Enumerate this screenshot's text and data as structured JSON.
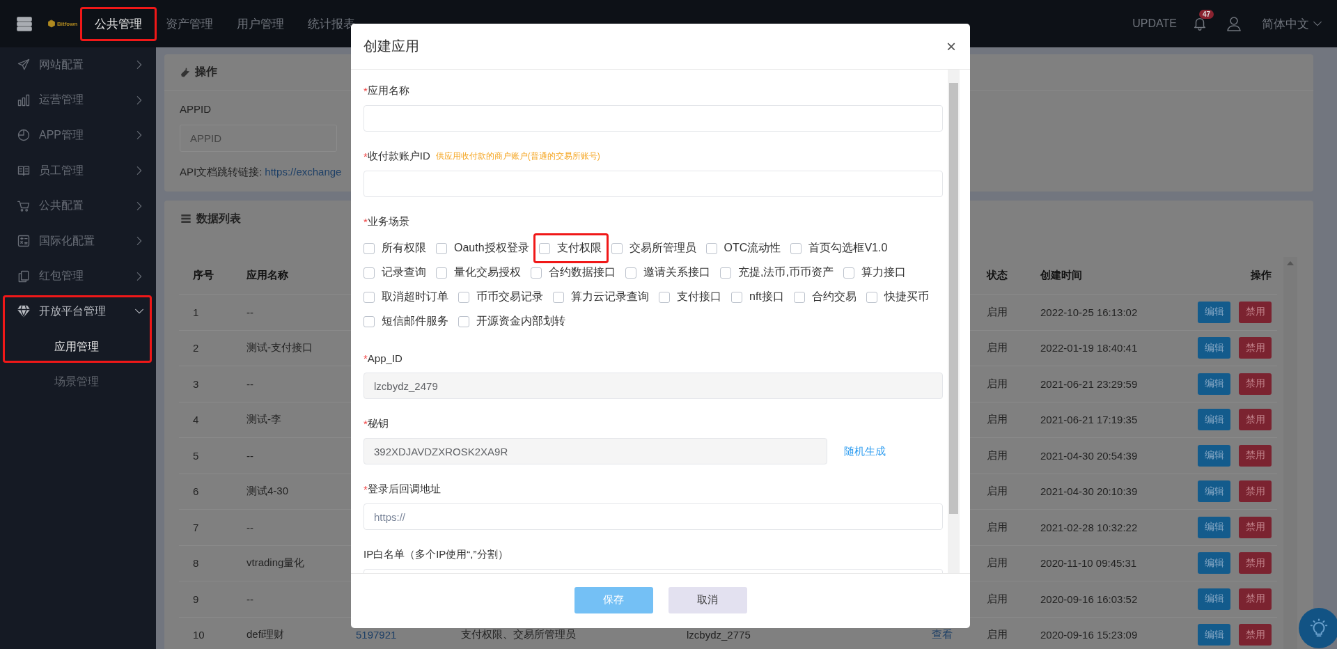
{
  "topbar": {
    "brand": "Bitfown",
    "nav": [
      {
        "label": "公共管理",
        "selected": true,
        "highlighted": true
      },
      {
        "label": "资产管理",
        "selected": false,
        "highlighted": false
      },
      {
        "label": "用户管理",
        "selected": false,
        "highlighted": false
      },
      {
        "label": "统计报表",
        "selected": false,
        "highlighted": false
      }
    ],
    "update": "UPDATE",
    "badge": "47",
    "language": "简体中文"
  },
  "sidebar": {
    "items": [
      {
        "label": "网站配置",
        "expanded": false,
        "highlighted": false
      },
      {
        "label": "运营管理",
        "expanded": false,
        "highlighted": false
      },
      {
        "label": "APP管理",
        "expanded": false,
        "highlighted": false
      },
      {
        "label": "员工管理",
        "expanded": false,
        "highlighted": false
      },
      {
        "label": "公共配置",
        "expanded": false,
        "highlighted": false
      },
      {
        "label": "国际化配置",
        "expanded": false,
        "highlighted": false
      },
      {
        "label": "红包管理",
        "expanded": false,
        "highlighted": false
      },
      {
        "label": "开放平台管理",
        "expanded": true,
        "highlighted": true,
        "children": [
          {
            "label": "应用管理",
            "selected": true
          },
          {
            "label": "场景管理",
            "selected": false
          }
        ]
      }
    ]
  },
  "operations": {
    "title": "操作",
    "appid_label": "APPID",
    "appid_placeholder": "APPID",
    "link_label": "API文档跳转链接:",
    "link": "https://exchange"
  },
  "table": {
    "title": "数据列表",
    "columns": [
      "序号",
      "应用名称",
      "状态",
      "创建时间",
      "操作"
    ],
    "rows": [
      {
        "no": "1",
        "name": "--",
        "status": "启用",
        "created": "2022-10-25 16:13:02",
        "actions": [
          "编辑",
          "禁用"
        ]
      },
      {
        "no": "2",
        "name": "测试-支付接口",
        "status": "启用",
        "created": "2022-01-19 18:40:41",
        "actions": [
          "编辑",
          "禁用"
        ]
      },
      {
        "no": "3",
        "name": "--",
        "status": "启用",
        "created": "2021-06-21 23:29:59",
        "actions": [
          "编辑",
          "禁用"
        ]
      },
      {
        "no": "4",
        "name": "测试-李",
        "status": "启用",
        "created": "2021-06-21 17:19:35",
        "actions": [
          "编辑",
          "禁用"
        ]
      },
      {
        "no": "5",
        "name": "--",
        "status": "启用",
        "created": "2021-04-30 20:54:39",
        "actions": [
          "编辑",
          "禁用"
        ]
      },
      {
        "no": "6",
        "name": "测试4-30",
        "status": "启用",
        "created": "2021-04-30 20:10:39",
        "actions": [
          "编辑",
          "禁用"
        ]
      },
      {
        "no": "7",
        "name": "--",
        "status": "启用",
        "created": "2021-02-28 10:32:22",
        "actions": [
          "编辑",
          "禁用"
        ]
      },
      {
        "no": "8",
        "name": "vtrading量化",
        "status": "启用",
        "created": "2020-11-10 09:45:31",
        "actions": [
          "编辑",
          "禁用"
        ]
      },
      {
        "no": "9",
        "name": "--",
        "status": "启用",
        "created": "2020-09-16 16:03:52",
        "actions": [
          "编辑",
          "禁用"
        ]
      },
      {
        "no": "10",
        "name": "defi理财",
        "column_3": "5197921",
        "column_4": "支付权限、交易所管理员",
        "column_5": "lzcbydz_2775",
        "column_6": "查看",
        "status": "启用",
        "created": "2020-09-16 15:23:09",
        "actions": [
          "编辑",
          "禁用"
        ]
      }
    ]
  },
  "dialog": {
    "title": "创建应用",
    "close": "×",
    "fields": [
      {
        "kind": "text",
        "mark": "*",
        "label": "应用名称"
      },
      {
        "kind": "text",
        "mark": "*",
        "label": "收付款账户ID",
        "hint": "供应用收付款的商户账户(普通的交易所账号)"
      },
      {
        "kind": "checkboxes",
        "mark": "*",
        "label": "业务场景",
        "options": [
          {
            "label": "所有权限",
            "checked": false,
            "highlighted": false
          },
          {
            "label": "Oauth授权登录",
            "checked": false,
            "highlighted": false
          },
          {
            "label": "支付权限",
            "checked": false,
            "highlighted": true
          },
          {
            "label": "交易所管理员",
            "checked": false,
            "highlighted": false
          },
          {
            "label": "OTC流动性",
            "checked": false,
            "highlighted": false
          },
          {
            "label": "首页勾选框V1.0",
            "checked": false,
            "highlighted": false
          },
          {
            "label": "记录查询",
            "checked": false,
            "highlighted": false
          },
          {
            "label": "量化交易授权",
            "checked": false,
            "highlighted": false
          },
          {
            "label": "合约数据接口",
            "checked": false,
            "highlighted": false
          },
          {
            "label": "邀请关系接口",
            "checked": false,
            "highlighted": false
          },
          {
            "label": "充提,法币,币币资产",
            "checked": false,
            "highlighted": false
          },
          {
            "label": "算力接口",
            "checked": false,
            "highlighted": false
          },
          {
            "label": "取消超时订单",
            "checked": false,
            "highlighted": false
          },
          {
            "label": "币币交易记录",
            "checked": false,
            "highlighted": false
          },
          {
            "label": "算力云记录查询",
            "checked": false,
            "highlighted": false
          },
          {
            "label": "支付接口",
            "checked": false,
            "highlighted": false
          },
          {
            "label": "nft接口",
            "checked": false,
            "highlighted": false
          },
          {
            "label": "合约交易",
            "checked": false,
            "highlighted": false
          },
          {
            "label": "快捷买币",
            "checked": false,
            "highlighted": false
          },
          {
            "label": "短信邮件服务",
            "checked": false,
            "highlighted": false
          },
          {
            "label": "开源资金内部划转",
            "checked": false,
            "highlighted": false
          }
        ]
      },
      {
        "kind": "readonly",
        "mark": "*",
        "label": "App_ID",
        "value": "lzcbydz_2479"
      },
      {
        "kind": "readonly",
        "mark": "*",
        "label": "秘钥",
        "value": "392XDJAVDZXROSK2XA9R",
        "action": "随机生成"
      },
      {
        "kind": "text",
        "mark": "*",
        "label": "登录后回调地址",
        "placeholder": "https://"
      },
      {
        "kind": "text",
        "label": "IP白名单（多个IP使用“,”分割）"
      }
    ],
    "buttons": [
      {
        "label": "保存",
        "kind": "primary"
      },
      {
        "label": "取消",
        "kind": "secondary"
      }
    ]
  }
}
